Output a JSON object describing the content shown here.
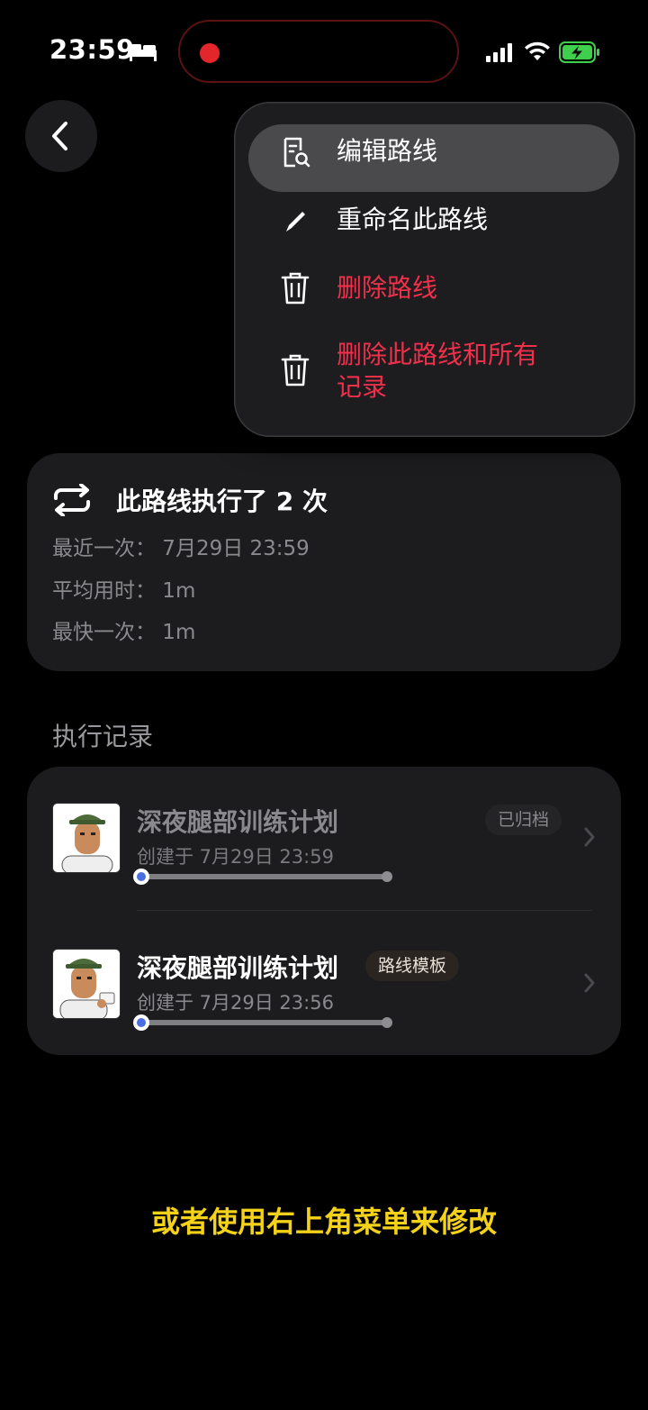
{
  "status_bar": {
    "time": "23:59",
    "battery_color": "#3ecf4c",
    "record_color": "#e2262c"
  },
  "menu": {
    "items": [
      {
        "label": "编辑路线",
        "icon": "edit-route-icon",
        "style": "normal",
        "highlighted": true
      },
      {
        "label": "重命名此路线",
        "icon": "pencil-icon",
        "style": "normal"
      },
      {
        "label": "删除路线",
        "icon": "trash-icon",
        "style": "danger"
      },
      {
        "label_line1": "删除此路线和所有",
        "label_line2": "记录",
        "icon": "trash-icon",
        "style": "danger"
      }
    ],
    "danger_color": "#f0304a"
  },
  "stats": {
    "title": "此路线执行了 2 次",
    "recent": "最近一次：  7月29日 23:59",
    "average": "平均用时：  1m",
    "fastest": "最快一次：  1m"
  },
  "records_section": {
    "title": "执行记录",
    "records": [
      {
        "name": "深夜腿部训练计划",
        "meta": "创建于 7月29日 23:59",
        "badge": "已归档",
        "progress": 0.0
      },
      {
        "name": "深夜腿部训练计划",
        "meta": "创建于 7月29日 23:56",
        "badge": "路线模板",
        "progress": 0.0
      }
    ]
  },
  "caption": "或者使用右上角菜单来修改",
  "caption_color": "#f5d21a"
}
